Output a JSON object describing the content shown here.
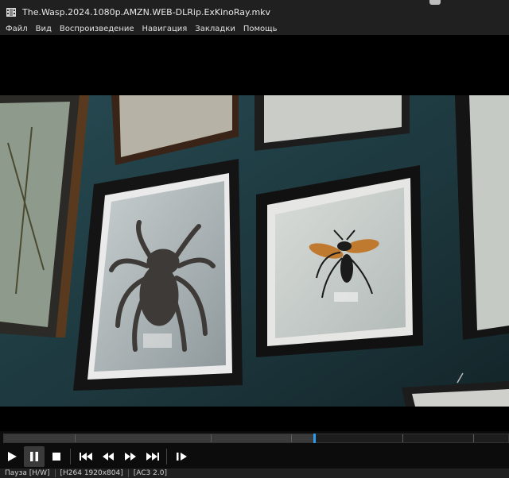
{
  "window": {
    "title": "The.Wasp.2024.1080p.AMZN.WEB-DLRip.ExKinoRay.mkv"
  },
  "menu": {
    "items": [
      "Файл",
      "Вид",
      "Воспроизведение",
      "Навигация",
      "Закладки",
      "Помощь"
    ]
  },
  "seekbar": {
    "position_fraction": 0.615,
    "chapter_fractions": [
      0.14,
      0.41,
      0.57,
      0.79,
      0.93
    ]
  },
  "controls": {
    "buttons": [
      "play-icon",
      "pause-icon",
      "stop-icon",
      "skip-previous-icon",
      "rewind-icon",
      "fast-forward-icon",
      "skip-next-icon",
      "frame-step-icon"
    ],
    "active": "pause-icon"
  },
  "status": {
    "state": "Пауза [H/W]",
    "video": "[H264 1920x804]",
    "audio": "[AC3 2.0]"
  },
  "colors": {
    "accent": "#2d9bf0",
    "wall": "#1f3a40"
  }
}
